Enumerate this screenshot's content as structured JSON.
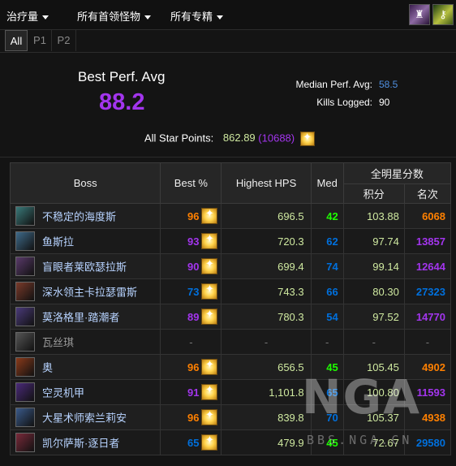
{
  "filters": {
    "metric": "治疗量",
    "bosses": "所有首领怪物",
    "specs": "所有专精"
  },
  "tabs": [
    "All",
    "P1",
    "P2"
  ],
  "summary": {
    "best_label": "Best Perf. Avg",
    "best_value": "88.2",
    "median_label": "Median Perf. Avg:",
    "median_value": "58.5",
    "kills_label": "Kills Logged:",
    "kills_value": "90",
    "stars_label": "All Star Points:",
    "stars_value": "862.89",
    "stars_paren_open": "(",
    "stars_total": "10688",
    "stars_paren_close": ")"
  },
  "table": {
    "headers": {
      "boss": "Boss",
      "best": "Best %",
      "hps": "Highest HPS",
      "med": "Med",
      "allstar": "全明星分数",
      "points": "积分",
      "rank": "名次"
    },
    "rows": [
      {
        "name": "不稳定的海度斯",
        "best": "96",
        "hps": "696.5",
        "med": "42",
        "points": "103.88",
        "rank": "6068",
        "icon": "hydross-icon"
      },
      {
        "name": "鱼斯拉",
        "best": "93",
        "hps": "720.3",
        "med": "62",
        "points": "97.74",
        "rank": "13857",
        "icon": "lurker-icon"
      },
      {
        "name": "盲眼者莱欧瑟拉斯",
        "best": "90",
        "hps": "699.4",
        "med": "74",
        "points": "99.14",
        "rank": "12644",
        "icon": "leotheras-icon"
      },
      {
        "name": "深水领主卡拉瑟雷斯",
        "best": "73",
        "hps": "743.3",
        "med": "66",
        "points": "80.30",
        "rank": "27323",
        "icon": "karathress-icon"
      },
      {
        "name": "莫洛格里·踏潮者",
        "best": "89",
        "hps": "780.3",
        "med": "54",
        "points": "97.52",
        "rank": "14770",
        "icon": "morogrim-icon"
      },
      {
        "name": "瓦丝琪",
        "best": "-",
        "hps": "-",
        "med": "-",
        "points": "-",
        "rank": "-",
        "icon": "vashj-icon"
      },
      {
        "name": "奥",
        "best": "96",
        "hps": "656.5",
        "med": "45",
        "points": "105.45",
        "rank": "4902",
        "icon": "alar-icon"
      },
      {
        "name": "空灵机甲",
        "best": "91",
        "hps": "1,101.8",
        "med": "65",
        "points": "100.80",
        "rank": "11593",
        "icon": "voidreaver-icon"
      },
      {
        "name": "大星术师索兰莉安",
        "best": "96",
        "hps": "839.8",
        "med": "70",
        "points": "105.37",
        "rank": "4938",
        "icon": "solarian-icon"
      },
      {
        "name": "凯尔萨斯·逐日者",
        "best": "65",
        "hps": "479.9",
        "med": "45",
        "points": "72.67",
        "rank": "29580",
        "icon": "kaelthas-icon"
      }
    ]
  },
  "watermark": {
    "logo": "NGA",
    "site": "BBS.NGA.CN"
  }
}
